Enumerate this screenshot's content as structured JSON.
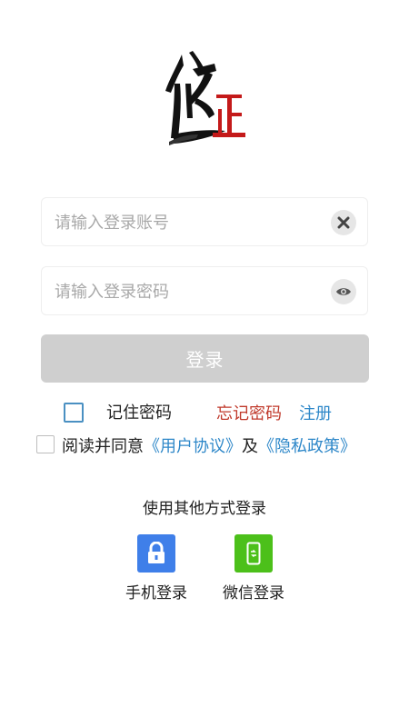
{
  "login_form": {
    "account_placeholder": "请输入登录账号",
    "password_placeholder": "请输入登录密码",
    "login_button": "登录"
  },
  "options": {
    "remember_password": "记住密码",
    "forgot_password": "忘记密码",
    "register": "注册"
  },
  "agreement": {
    "prefix": "阅读并同意",
    "user_agreement": "《用户协议》",
    "conjunction": "及",
    "privacy_policy": "《隐私政策》"
  },
  "other_login": {
    "heading": "使用其他方式登录",
    "methods": [
      {
        "label": "手机登录",
        "icon": "lock-icon",
        "color": "#3f7fe9"
      },
      {
        "label": "微信登录",
        "icon": "phone-icon",
        "color": "#4cc01a"
      }
    ]
  },
  "colors": {
    "forgot": "#c0392b",
    "link": "#2f88c9",
    "checkbox_blue": "#4a90c2"
  }
}
